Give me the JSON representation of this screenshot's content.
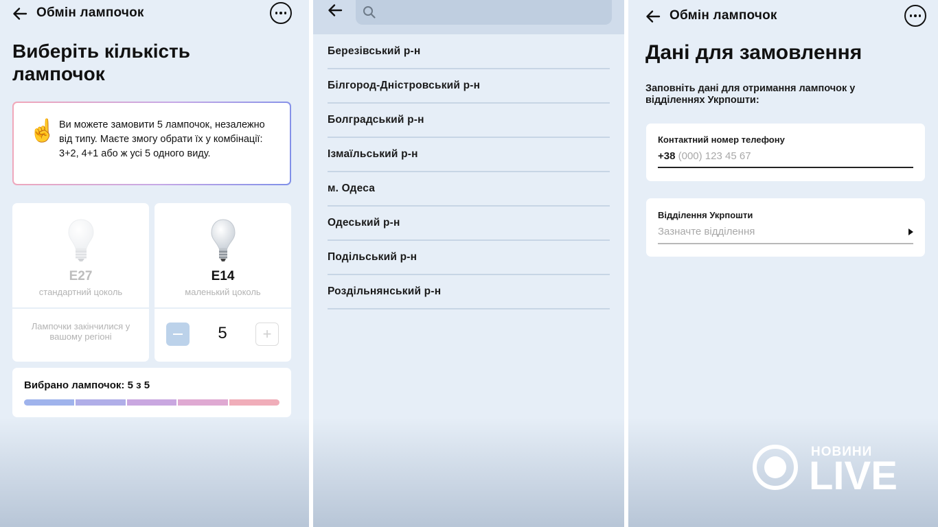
{
  "panel1": {
    "header": {
      "title": "Обмін лампочок"
    },
    "heading": "Виберіть кількість лампочок",
    "info": {
      "emoji": "☝️",
      "text": "Ви можете замовити 5 лампочок, незалежно від типу. Маєте змогу обрати їх у комбінації: 3+2, 4+1 або ж усі 5 одного виду."
    },
    "lamps": [
      {
        "code": "E27",
        "subtitle": "стандартний цоколь",
        "status": "Лампочки закінчилися у вашому регіоні",
        "available": false
      },
      {
        "code": "E14",
        "subtitle": "маленький цоколь",
        "quantity": "5",
        "minus": "−",
        "plus": "+",
        "available": true
      }
    ],
    "selected": {
      "text": "Вибрано лампочок: 5 з 5",
      "filled": 5,
      "total": 5
    }
  },
  "panel2": {
    "search": {
      "placeholder": ""
    },
    "districts": [
      "Березівський р-н",
      "Білгород-Дністровський р-н",
      "Болградський р-н",
      "Ізмаїльський р-н",
      "м. Одеса",
      "Одеський р-н",
      "Подільський р-н",
      "Роздільнянський р-н"
    ]
  },
  "panel3": {
    "header": {
      "title": "Обмін лампочок"
    },
    "heading": "Дані для замовлення",
    "description": "Заповніть дані для отримання лампочок у відділеннях Укрпошти:",
    "phone": {
      "label": "Контактний номер телефону",
      "prefix": "+38",
      "placeholder": "(000) 123 45 67"
    },
    "office": {
      "label": "Відділення Укрпошти",
      "placeholder": "Зазначте відділення"
    }
  },
  "logo": {
    "small": "НОВИНИ",
    "big": "LIVE"
  },
  "colors": {
    "background": "#e6eef7",
    "card": "#ffffff",
    "progress": [
      "#9fb3ec",
      "#b0aee8",
      "#c9a7e0",
      "#dfa9d2",
      "#f0adb9"
    ],
    "stepper_minus": "#bcd2ea"
  }
}
